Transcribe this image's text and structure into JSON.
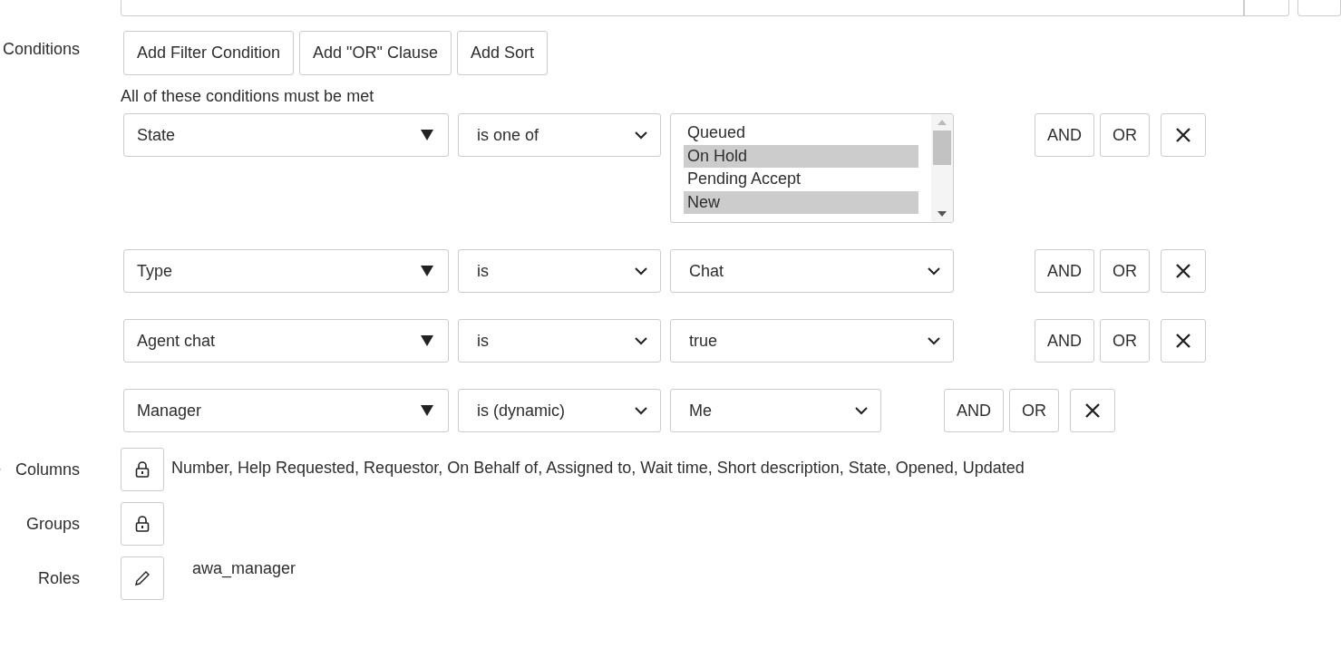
{
  "conditions": {
    "label": "Conditions",
    "buttons": [
      "Add Filter Condition",
      "Add \"OR\" Clause",
      "Add Sort"
    ],
    "note": "All of these conditions must be met",
    "rows": [
      {
        "field": "State",
        "operator": "is one of",
        "kind": "listbox",
        "options": [
          {
            "label": "Queued",
            "selected": false
          },
          {
            "label": "On Hold",
            "selected": true
          },
          {
            "label": "Pending Accept",
            "selected": false
          },
          {
            "label": "New",
            "selected": true
          }
        ],
        "and_label": "AND",
        "or_label": "OR"
      },
      {
        "field": "Type",
        "operator": "is",
        "kind": "select",
        "value": "Chat",
        "and_label": "AND",
        "or_label": "OR"
      },
      {
        "field": "Agent chat",
        "operator": "is",
        "kind": "select",
        "value": "true",
        "and_label": "AND",
        "or_label": "OR"
      },
      {
        "field": "Manager",
        "operator": "is (dynamic)",
        "kind": "dynamic",
        "value": "Me",
        "and_label": "AND",
        "or_label": "OR"
      }
    ]
  },
  "columns": {
    "label": "Columns",
    "value": "Number, Help Requested, Requestor, On Behalf of, Assigned to, Wait time, Short description, State, Opened, Updated"
  },
  "groups": {
    "label": "Groups"
  },
  "roles": {
    "label": "Roles",
    "value": "awa_manager"
  }
}
